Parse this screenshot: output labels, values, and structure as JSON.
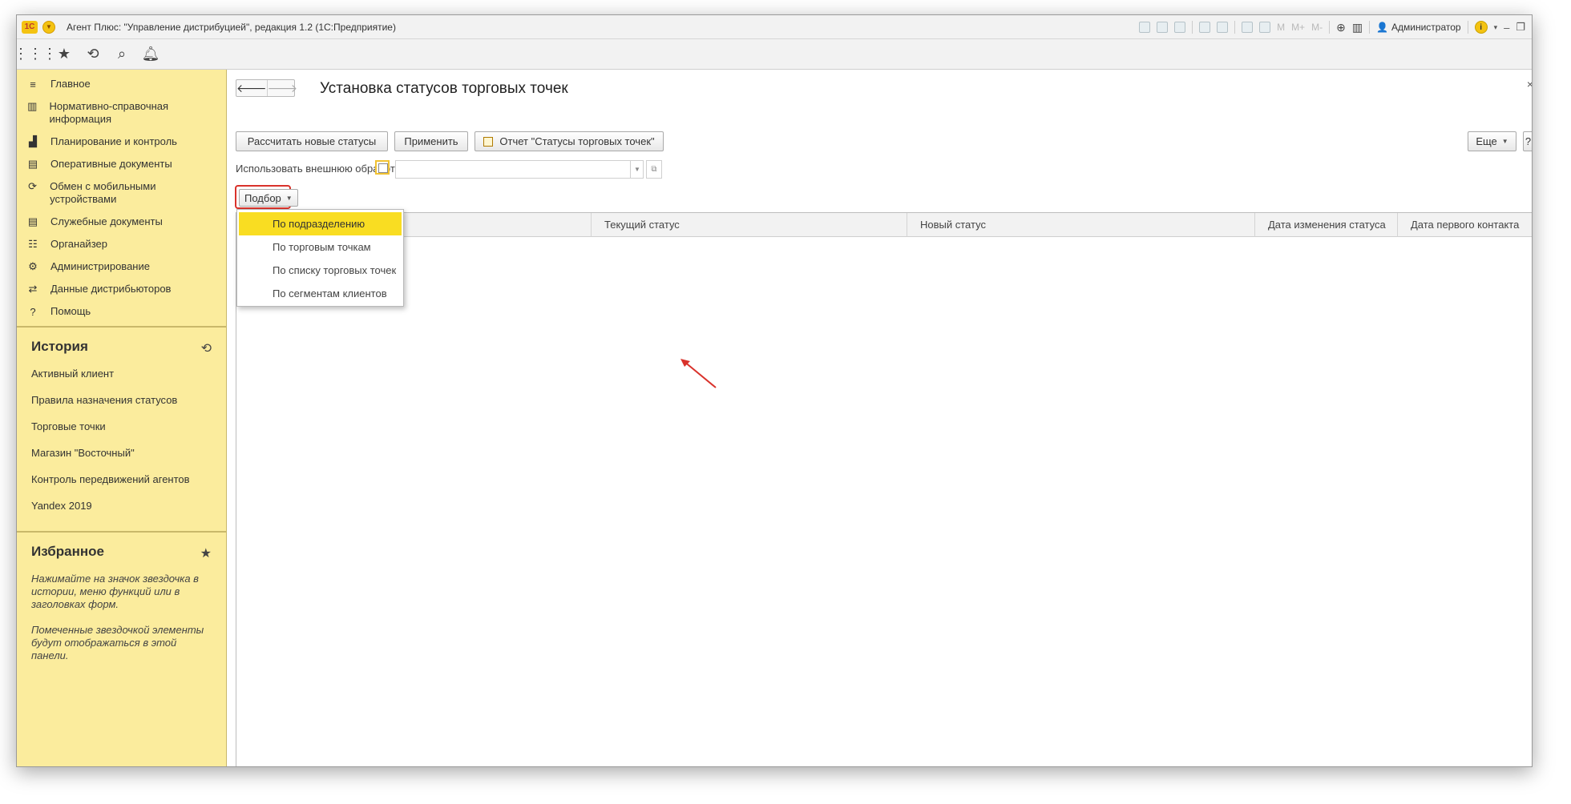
{
  "window": {
    "title": "Агент Плюс: \"Управление дистрибуцией\", редакция 1.2  (1С:Предприятие)",
    "logo": "1С",
    "user": "Администратор",
    "title_tools": [
      "M",
      "M+",
      "M-"
    ]
  },
  "sidebar": {
    "items": [
      {
        "icon": "menu-lines-icon",
        "label": "Главное"
      },
      {
        "icon": "book-icon",
        "label": "Нормативно-справочная информация"
      },
      {
        "icon": "chart-icon",
        "label": "Планирование и контроль"
      },
      {
        "icon": "documents-icon",
        "label": "Оперативные документы"
      },
      {
        "icon": "sync-icon",
        "label": "Обмен с мобильными устройствами"
      },
      {
        "icon": "service-docs-icon",
        "label": "Служебные документы"
      },
      {
        "icon": "organizer-icon",
        "label": "Органайзер"
      },
      {
        "icon": "gear-icon",
        "label": "Администрирование"
      },
      {
        "icon": "distributor-icon",
        "label": "Данные дистрибьюторов"
      },
      {
        "icon": "question-icon",
        "label": "Помощь"
      }
    ],
    "history": {
      "title": "История",
      "items": [
        "Активный клиент",
        "Правила назначения статусов",
        "Торговые точки",
        "Магазин \"Восточный\"",
        "Контроль передвижений агентов",
        "Yandex 2019"
      ]
    },
    "favorites": {
      "title": "Избранное",
      "hint1": "Нажимайте на значок звездочка в истории, меню функций или в заголовках форм.",
      "hint2": "Помеченные звездочкой элементы будут отображаться в этой панели."
    }
  },
  "form": {
    "title": "Установка статусов торговых точек",
    "buttons": {
      "calc": "Рассчитать новые статусы",
      "apply": "Применить",
      "report": "Отчет \"Статусы торговых точек\"",
      "more": "Еще",
      "help": "?"
    },
    "external_label": "Использовать внешнюю обработку:",
    "podbor": "Подбор",
    "dropdown": [
      "По подразделению",
      "По торговым точкам",
      "По списку торговых точек",
      "По сегментам клиентов"
    ],
    "columns": [
      "Текущий статус",
      "Новый статус",
      "Дата изменения статуса",
      "Дата первого контакта"
    ]
  },
  "colors": {
    "sidebar_bg": "#fbec9d",
    "highlight": "#f9dd22",
    "annotation": "#d9322b"
  }
}
